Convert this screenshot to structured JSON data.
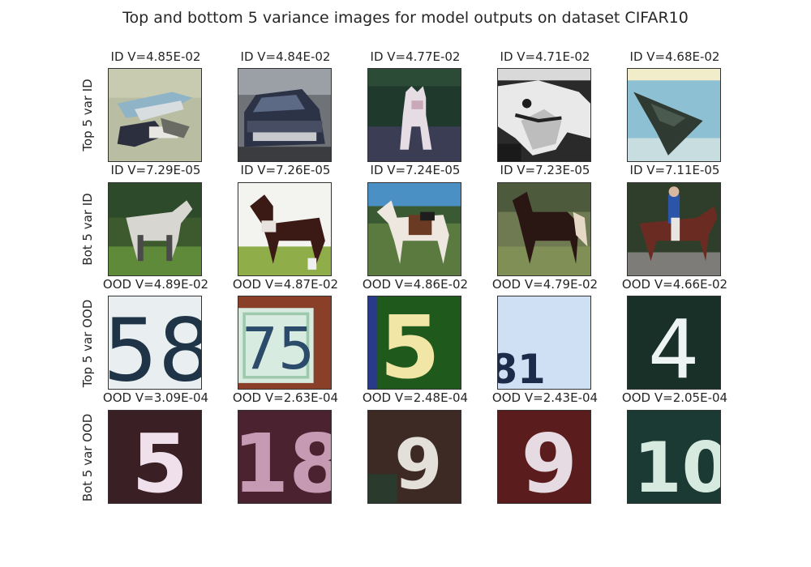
{
  "title": "Top and bottom 5 variance images for model outputs on dataset CIFAR10",
  "rows": [
    {
      "label": "Top 5 var ID",
      "cells": [
        {
          "caption": "ID V=4.85E-02",
          "image": "airplane-toy-icon"
        },
        {
          "caption": "ID V=4.84E-02",
          "image": "car-icon"
        },
        {
          "caption": "ID V=4.77E-02",
          "image": "cat-standing-icon"
        },
        {
          "caption": "ID V=4.71E-02",
          "image": "horse-head-bw-icon"
        },
        {
          "caption": "ID V=4.68E-02",
          "image": "stealth-jet-icon"
        }
      ]
    },
    {
      "label": "Bot 5 var ID",
      "cells": [
        {
          "caption": "ID V=7.29E-05",
          "image": "horse-white-icon"
        },
        {
          "caption": "ID V=7.26E-05",
          "image": "horse-brown-icon"
        },
        {
          "caption": "ID V=7.24E-05",
          "image": "horse-pinto-icon"
        },
        {
          "caption": "ID V=7.23E-05",
          "image": "horse-dark-icon"
        },
        {
          "caption": "ID V=7.11E-05",
          "image": "horse-rider-icon"
        }
      ]
    },
    {
      "label": "Top 5 var OOD",
      "cells": [
        {
          "caption": "OOD V=4.89E-02",
          "image": "digit-58-icon"
        },
        {
          "caption": "OOD V=4.87E-02",
          "image": "digit-75-icon"
        },
        {
          "caption": "OOD V=4.86E-02",
          "image": "digit-5-green-icon"
        },
        {
          "caption": "OOD V=4.79E-02",
          "image": "digit-81-icon"
        },
        {
          "caption": "OOD V=4.66E-02",
          "image": "digit-4-icon"
        }
      ]
    },
    {
      "label": "Bot 5 var OOD",
      "cells": [
        {
          "caption": "OOD V=3.09E-04",
          "image": "digit-5-dark-icon"
        },
        {
          "caption": "OOD V=2.63E-04",
          "image": "digit-18-icon"
        },
        {
          "caption": "OOD V=2.48E-04",
          "image": "digit-9-icon"
        },
        {
          "caption": "OOD V=2.43E-04",
          "image": "digit-9-red-icon"
        },
        {
          "caption": "OOD V=2.05E-04",
          "image": "digit-10-icon"
        }
      ]
    }
  ]
}
